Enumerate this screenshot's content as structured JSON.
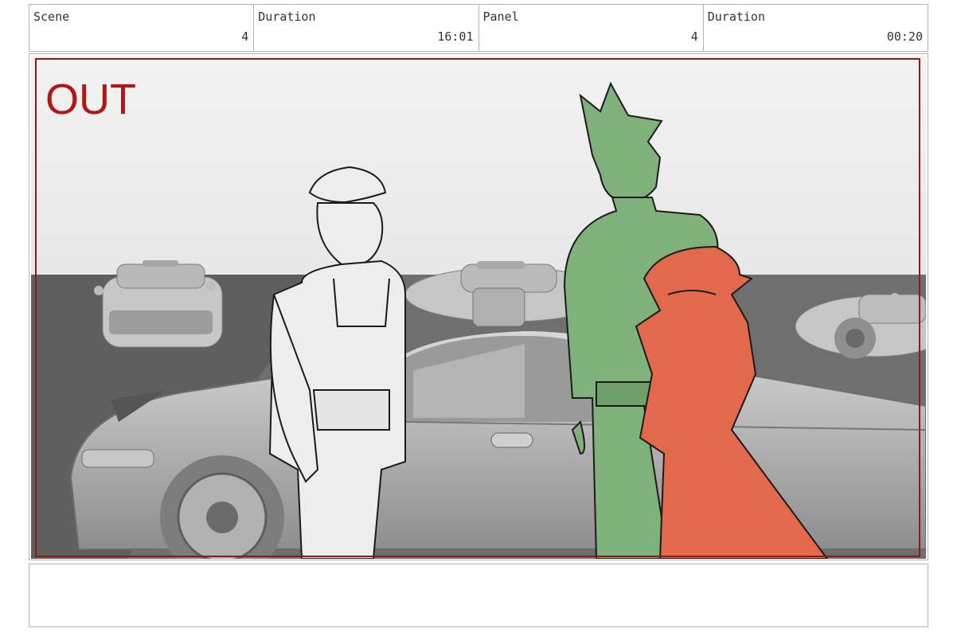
{
  "header": {
    "scene_label": "Scene",
    "scene_value": "4",
    "scene_duration_label": "Duration",
    "scene_duration_value": "16:01",
    "panel_label": "Panel",
    "panel_value": "4",
    "panel_duration_label": "Duration",
    "panel_duration_value": "00:20"
  },
  "panel": {
    "overlay_text": "OUT",
    "overlay_color": "#b01818",
    "safe_frame_color": "#8b1a1a",
    "character_green_color": "#7fb27a",
    "character_red_color": "#e2694c",
    "background_color": "#d9d9d9"
  },
  "notes": {
    "text": ""
  }
}
